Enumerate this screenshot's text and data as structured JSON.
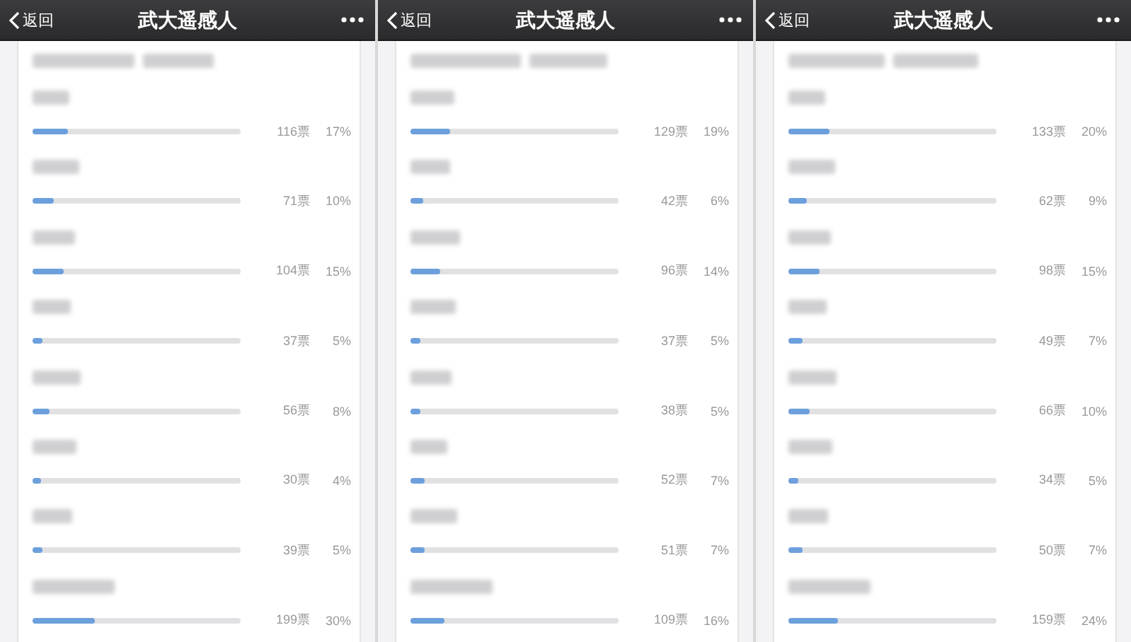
{
  "panels": [
    {
      "header": {
        "back": "返回",
        "title": "武大遥感人"
      },
      "options": [
        {
          "votes": "116票",
          "percent": "17%",
          "level": 0.17
        },
        {
          "votes": "71票",
          "percent": "10%",
          "level": 0.1
        },
        {
          "votes": "104票",
          "percent": "15%",
          "level": 0.15
        },
        {
          "votes": "37票",
          "percent": "5%",
          "level": 0.05
        },
        {
          "votes": "56票",
          "percent": "8%",
          "level": 0.08
        },
        {
          "votes": "30票",
          "percent": "4%",
          "level": 0.04
        },
        {
          "votes": "39票",
          "percent": "5%",
          "level": 0.05
        },
        {
          "votes": "199票",
          "percent": "30%",
          "level": 0.3
        }
      ]
    },
    {
      "header": {
        "back": "返回",
        "title": "武大遥感人"
      },
      "options": [
        {
          "votes": "129票",
          "percent": "19%",
          "level": 0.19
        },
        {
          "votes": "42票",
          "percent": "6%",
          "level": 0.06
        },
        {
          "votes": "96票",
          "percent": "14%",
          "level": 0.14
        },
        {
          "votes": "37票",
          "percent": "5%",
          "level": 0.05
        },
        {
          "votes": "38票",
          "percent": "5%",
          "level": 0.05
        },
        {
          "votes": "52票",
          "percent": "7%",
          "level": 0.07
        },
        {
          "votes": "51票",
          "percent": "7%",
          "level": 0.07
        },
        {
          "votes": "109票",
          "percent": "16%",
          "level": 0.16
        }
      ]
    },
    {
      "header": {
        "back": "返回",
        "title": "武大遥感人"
      },
      "options": [
        {
          "votes": "133票",
          "percent": "20%",
          "level": 0.2
        },
        {
          "votes": "62票",
          "percent": "9%",
          "level": 0.09
        },
        {
          "votes": "98票",
          "percent": "15%",
          "level": 0.15
        },
        {
          "votes": "49票",
          "percent": "7%",
          "level": 0.07
        },
        {
          "votes": "66票",
          "percent": "10%",
          "level": 0.1
        },
        {
          "votes": "34票",
          "percent": "5%",
          "level": 0.05
        },
        {
          "votes": "50票",
          "percent": "7%",
          "level": 0.07
        },
        {
          "votes": "159票",
          "percent": "24%",
          "level": 0.24
        }
      ]
    }
  ]
}
